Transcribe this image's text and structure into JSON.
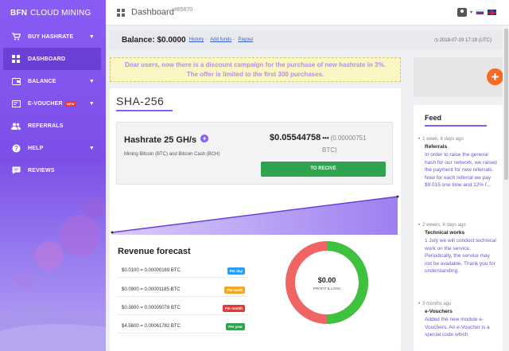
{
  "brand": {
    "bold": "BFN",
    "rest": "CLOUD MINING"
  },
  "sidebar": {
    "items": [
      {
        "label": "BUY HASHRATE",
        "icon": "cart-icon",
        "caret": "▼"
      },
      {
        "label": "DASHBOARD",
        "icon": "dashboard-icon"
      },
      {
        "label": "BALANCE",
        "icon": "wallet-icon",
        "caret": "▼"
      },
      {
        "label": "E-VOUCHER",
        "icon": "voucher-icon",
        "badge": "NEW",
        "caret": "▼"
      },
      {
        "label": "REFERRALS",
        "icon": "users-icon"
      },
      {
        "label": "HELP",
        "icon": "help-icon",
        "caret": "▼"
      },
      {
        "label": "REVIEWS",
        "icon": "chat-icon"
      }
    ]
  },
  "header": {
    "title": "Dashboard",
    "id": "#85870"
  },
  "balance": {
    "label": "Balance: $0.0000",
    "links": [
      "History",
      "Add funds",
      "Payout"
    ],
    "sep": "-",
    "time": "2018-07-19 17:19 (UTC)"
  },
  "notice": {
    "line1": "Dear users, now there is a discount campaign for the purchase of new hashrate in 3%.",
    "line2": "The offer is limited to the first 300 purchases."
  },
  "plan": {
    "title": "SHA-256",
    "hashrate": "Hashrate 25 GH/s",
    "description": "Mining Bitcoin (BTC) and Bitcoin Cash (BCH)",
    "earning_usd": "$0.05544758",
    "earning_dots": "•••",
    "earning_btc": "(0.00000751",
    "earning_btc_unit": "BTC)",
    "receive_button": "TO RECIVE"
  },
  "forecast": {
    "title": "Revenue forecast",
    "rows": [
      {
        "value": "$0.0100 = 0.00000169 BTC",
        "tag": "Per day",
        "color": "#2a9df4"
      },
      {
        "value": "$0.0900 = 0.00001185 BTC",
        "tag": "Per week",
        "color": "#f5a623"
      },
      {
        "value": "$0.3800 = 0.00005078 BTC",
        "tag": "Per month",
        "color": "#e53935"
      },
      {
        "value": "$4.5600 = 0.00061782 BTC",
        "tag": "Per year",
        "color": "#2ea44f"
      }
    ],
    "donut_amount": "$0.00",
    "donut_label": "PROFIT & LOSS",
    "donut_profit_fraction": 0.5,
    "donut_colors": {
      "profit": "#3cc23c",
      "loss": "#f06464"
    }
  },
  "feed": {
    "title": "Feed",
    "items": [
      {
        "when": "1 week, 6 days ago",
        "head": "Referrals",
        "body": "In order to raise the general hash for our network, we raised the payment for new referrals. Now for each referral we pay $9.015 one time and 12% f..."
      },
      {
        "when": "2 weeks, 6 days ago",
        "head": "Technical works",
        "body": "1 July we will conduct technical work on the service. Periodically, the service may not be available. Thank you for understanding."
      },
      {
        "when": "3 months ago",
        "head": "e-Vouchers",
        "body": "Added the new module e-Vouchers. An e-Voucher is a special code which"
      }
    ]
  }
}
